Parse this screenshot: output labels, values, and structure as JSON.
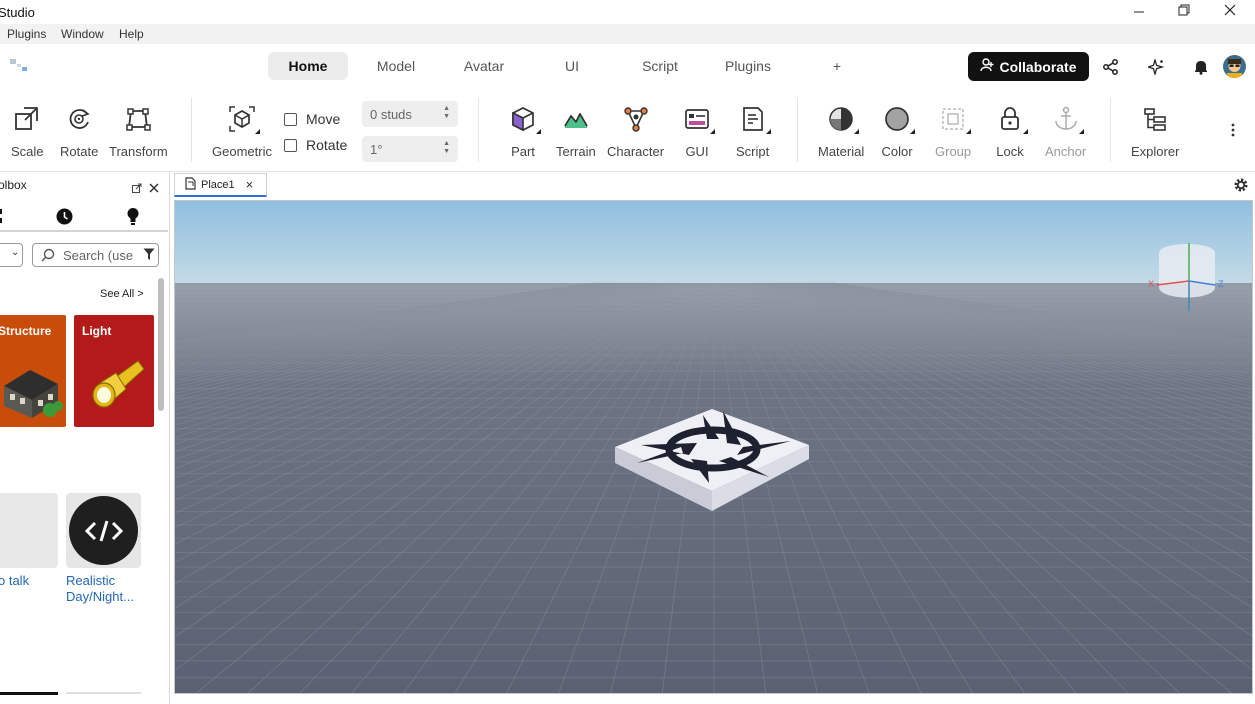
{
  "window": {
    "title": "Studio",
    "controls": [
      "minimize",
      "restore",
      "close"
    ]
  },
  "menu": [
    "Plugins",
    "Window",
    "Help"
  ],
  "tabs": [
    {
      "label": "Home",
      "active": true
    },
    {
      "label": "Model",
      "active": false
    },
    {
      "label": "Avatar",
      "active": false
    },
    {
      "label": "UI",
      "active": false
    },
    {
      "label": "Script",
      "active": false
    },
    {
      "label": "Plugins",
      "active": false
    },
    {
      "label": "+",
      "active": false
    }
  ],
  "header_right": {
    "collaborate_label": "Collaborate",
    "icons": [
      "share-icon",
      "assistant-sparkle-icon",
      "notification-bell-icon",
      "user-avatar"
    ]
  },
  "ribbon": {
    "transform_tools": [
      {
        "label": "Scale",
        "icon": "scale-icon"
      },
      {
        "label": "Rotate",
        "icon": "rotate-icon"
      },
      {
        "label": "Transform",
        "icon": "transform-icon"
      }
    ],
    "geometric": {
      "label": "Geometric",
      "icon": "geometric-icon"
    },
    "snap": {
      "move_label": "Move",
      "move_checked": false,
      "rotate_label": "Rotate",
      "rotate_checked": false,
      "move_value": "0 studs",
      "rotate_value": "1°"
    },
    "insert_tools": [
      {
        "label": "Part",
        "icon": "part-cube-icon"
      },
      {
        "label": "Terrain",
        "icon": "terrain-icon"
      },
      {
        "label": "Character",
        "icon": "character-icon"
      },
      {
        "label": "GUI",
        "icon": "gui-icon"
      },
      {
        "label": "Script",
        "icon": "script-icon"
      }
    ],
    "edit_tools": [
      {
        "label": "Material",
        "icon": "material-icon",
        "enabled": true
      },
      {
        "label": "Color",
        "icon": "color-icon",
        "enabled": true
      },
      {
        "label": "Group",
        "icon": "group-icon",
        "enabled": false
      },
      {
        "label": "Lock",
        "icon": "lock-icon",
        "enabled": true
      },
      {
        "label": "Anchor",
        "icon": "anchor-icon",
        "enabled": false
      }
    ],
    "explorer": {
      "label": "Explorer",
      "icon": "explorer-icon"
    }
  },
  "toolbox": {
    "header": "olbox",
    "tab_icons": [
      "grid-icon",
      "recent-clock-icon",
      "idea-bulb-icon"
    ],
    "search_placeholder": "Search (use",
    "see_all": "See All >",
    "categories": [
      {
        "label": "Structure",
        "color": "#c84d0a"
      },
      {
        "label": "Light",
        "color": "#b31a1a"
      }
    ],
    "items": [
      {
        "label_line1": "o talk",
        "label_line2": ""
      },
      {
        "label_line1": "Realistic",
        "label_line2": "Day/Night..."
      }
    ]
  },
  "document_tab": {
    "label": "Place1"
  },
  "viewport": {
    "sky_top": "#8fc0e0",
    "horizon": "#c7dbe6",
    "ground": "#5d6474",
    "gizmo_axes": [
      "X",
      "Z"
    ]
  }
}
